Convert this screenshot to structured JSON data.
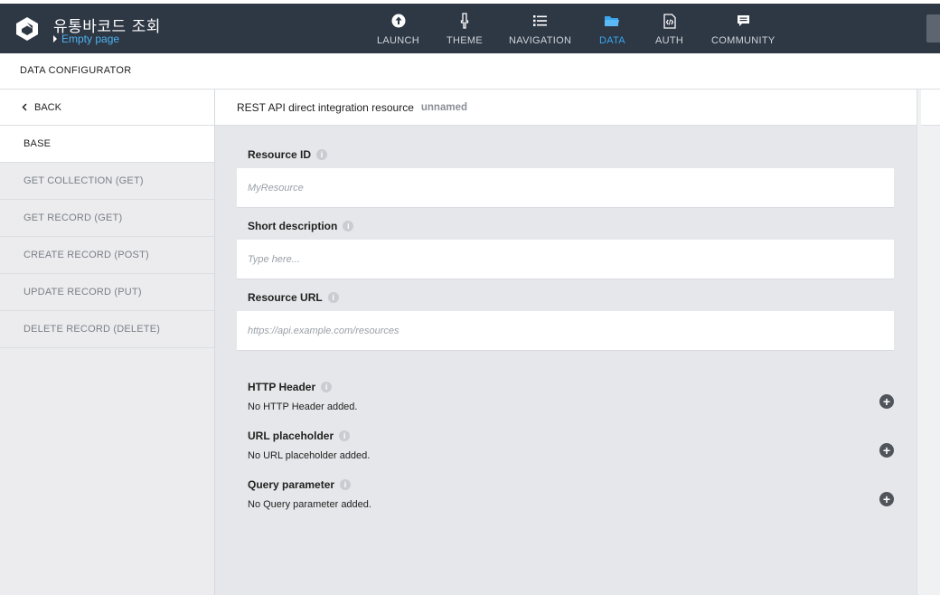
{
  "app": {
    "title": "유통바코드 조회",
    "subtitle": "Empty page"
  },
  "nav": [
    {
      "label": "LAUNCH",
      "icon": "upload-icon"
    },
    {
      "label": "THEME",
      "icon": "brush-icon"
    },
    {
      "label": "NAVIGATION",
      "icon": "list-icon"
    },
    {
      "label": "DATA",
      "icon": "folder-icon",
      "active": true
    },
    {
      "label": "AUTH",
      "icon": "code-file-icon"
    },
    {
      "label": "COMMUNITY",
      "icon": "chat-icon"
    }
  ],
  "subheader": {
    "title": "DATA CONFIGURATOR"
  },
  "sidebar": {
    "back_label": "BACK",
    "items": [
      {
        "label": "BASE",
        "active": true
      },
      {
        "label": "GET COLLECTION (GET)"
      },
      {
        "label": "GET RECORD (GET)"
      },
      {
        "label": "CREATE RECORD (POST)"
      },
      {
        "label": "UPDATE RECORD (PUT)"
      },
      {
        "label": "DELETE RECORD (DELETE)"
      }
    ]
  },
  "main": {
    "header_label": "REST API direct integration resource",
    "header_name": "unnamed",
    "fields": {
      "resource_id": {
        "label": "Resource ID",
        "placeholder": "MyResource"
      },
      "short_description": {
        "label": "Short description",
        "placeholder": "Type here..."
      },
      "resource_url": {
        "label": "Resource URL",
        "placeholder": "https://api.example.com/resources"
      }
    },
    "sections": {
      "http_header": {
        "title": "HTTP Header",
        "empty": "No HTTP Header added."
      },
      "url_placeholder": {
        "title": "URL placeholder",
        "empty": "No URL placeholder added."
      },
      "query_parameter": {
        "title": "Query parameter",
        "empty": "No Query parameter added."
      }
    }
  },
  "colors": {
    "topbar": "#2e3744",
    "accent": "#3aa7ef",
    "sidebar_bg": "#ececef",
    "main_bg": "#e6e7ea"
  }
}
